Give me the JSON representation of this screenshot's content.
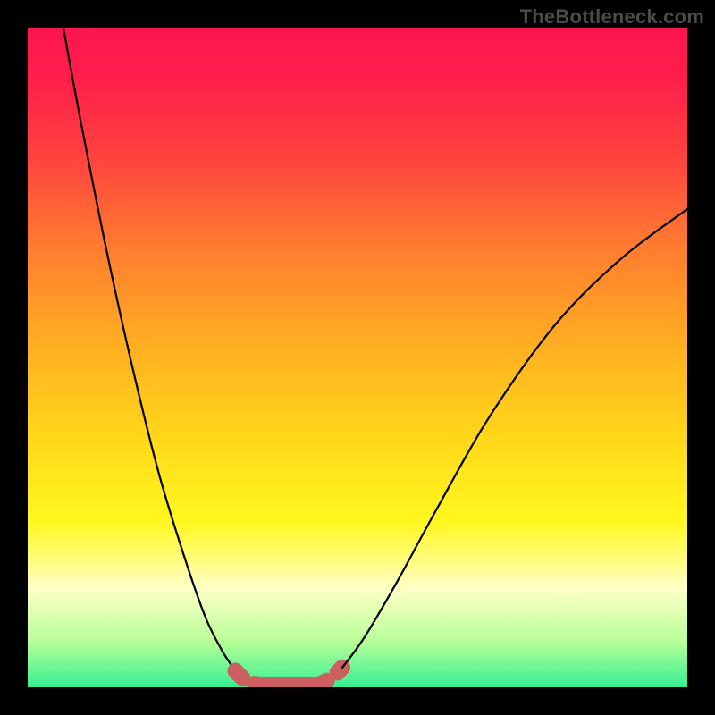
{
  "watermark_text": "TheBottleneck.com",
  "chart_data": {
    "type": "line",
    "title": "",
    "xlabel": "",
    "ylabel": "",
    "xlim": [
      0,
      100
    ],
    "ylim": [
      0,
      100
    ],
    "grid": false,
    "series": [
      {
        "name": "left-descent",
        "style": "thin-black",
        "x": [
          5.4,
          8,
          12,
          16,
          20,
          24,
          27,
          29.5,
          31.5
        ],
        "y": [
          100,
          86,
          66,
          48,
          32,
          19,
          10.5,
          5.5,
          2.5
        ]
      },
      {
        "name": "left-dashes",
        "style": "thick-salmon",
        "x": [
          31.5,
          32.6,
          33.8,
          35.0
        ],
        "y": [
          2.5,
          1.4,
          0.7,
          0.4
        ]
      },
      {
        "name": "valley-flat",
        "style": "thick-salmon",
        "x": [
          35.0,
          38.0,
          41.0,
          44.0
        ],
        "y": [
          0.4,
          0.3,
          0.3,
          0.4
        ]
      },
      {
        "name": "right-dashes",
        "style": "thick-salmon",
        "x": [
          44.0,
          45.2,
          46.5,
          47.7
        ],
        "y": [
          0.4,
          0.9,
          1.8,
          3.0
        ]
      },
      {
        "name": "right-ascent",
        "style": "thin-black",
        "x": [
          47.7,
          51,
          56,
          62,
          70,
          80,
          90,
          100
        ],
        "y": [
          3.0,
          7.5,
          16,
          27,
          41,
          55,
          65,
          72.5
        ]
      }
    ],
    "colors": {
      "thin-black": "#000000",
      "thick-salmon": "#cc5f5f"
    }
  }
}
